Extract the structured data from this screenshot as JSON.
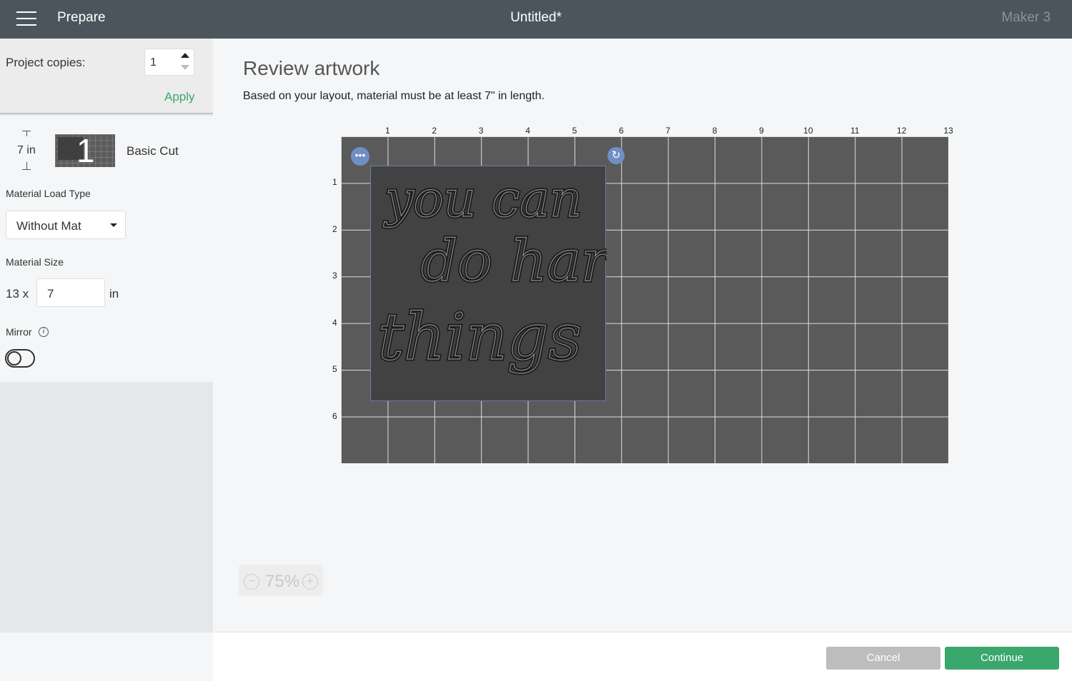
{
  "header": {
    "section": "Prepare",
    "title": "Untitled*",
    "machine": "Maker 3"
  },
  "sidebar": {
    "copies_label": "Project copies:",
    "copies_value": "1",
    "apply": "Apply",
    "mat": {
      "length": "7 in",
      "number": "1",
      "name": "Basic Cut"
    },
    "load_type_label": "Material Load Type",
    "load_type_value": "Without Mat",
    "size_label": "Material Size",
    "size_width": "13 x",
    "size_length": "7",
    "size_unit": "in",
    "mirror_label": "Mirror",
    "mirror_on": false
  },
  "main": {
    "title": "Review artwork",
    "subtitle": "Based on your layout, material must be at least 7\" in length.",
    "x_ticks": [
      "1",
      "2",
      "3",
      "4",
      "5",
      "6",
      "7",
      "8",
      "9",
      "10",
      "11",
      "12",
      "13"
    ],
    "y_ticks": [
      "1",
      "2",
      "3",
      "4",
      "5",
      "6"
    ],
    "artwork_text": "you can do hard things",
    "zoom": "75%"
  },
  "footer": {
    "cancel": "Cancel",
    "continue": "Continue"
  },
  "colors": {
    "header": "#4b555b",
    "accent": "#3aa76d",
    "mat": "#5a5a5a",
    "continue": "#3aa76d",
    "cancel": "#bdbdbd"
  }
}
